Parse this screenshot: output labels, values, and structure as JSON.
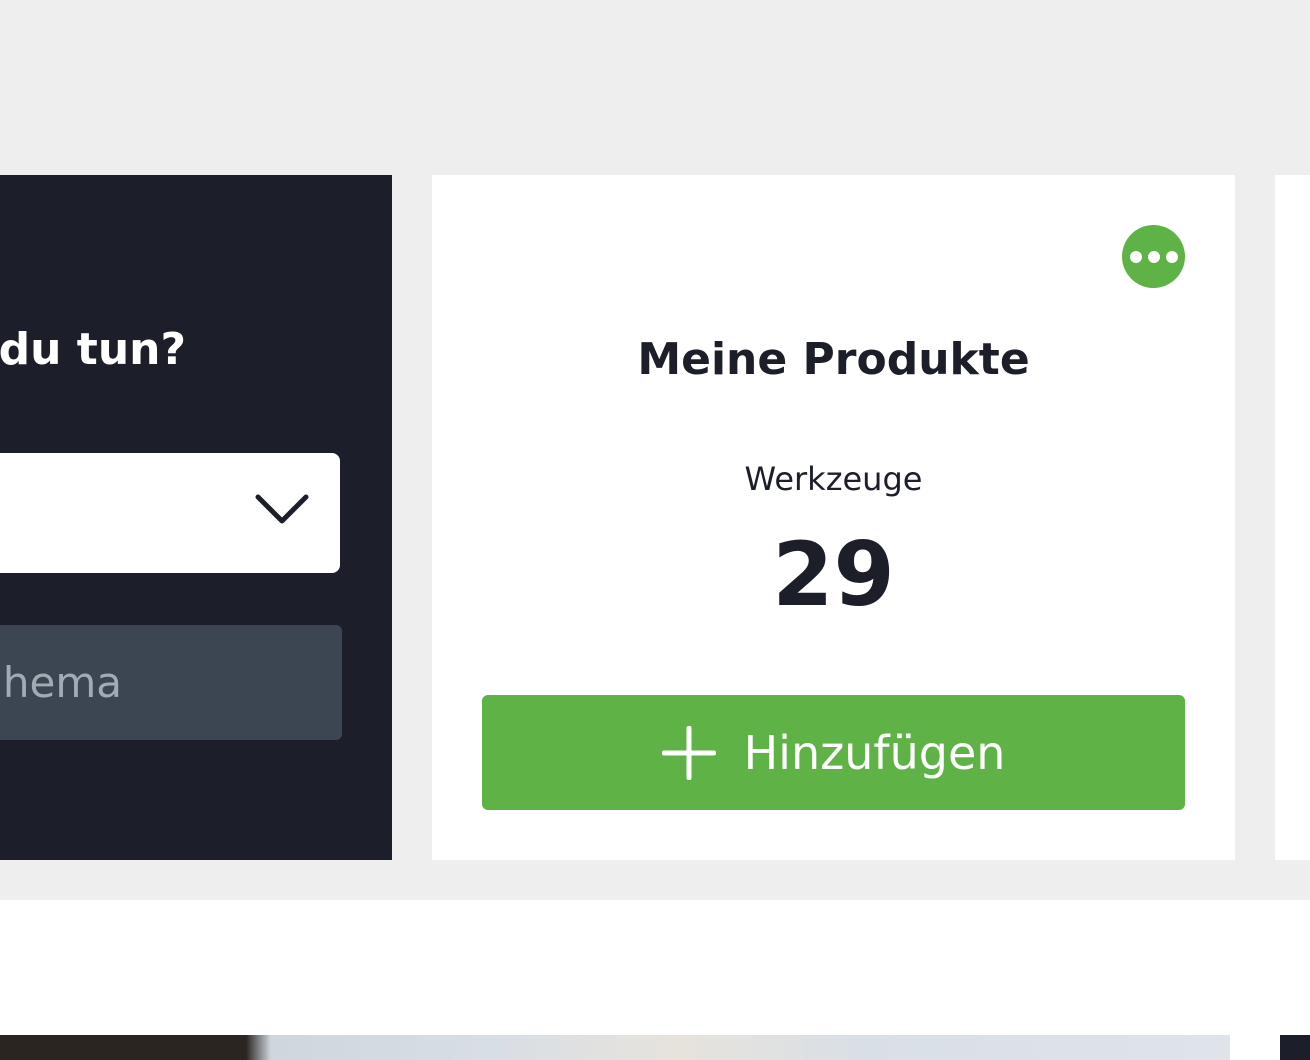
{
  "question_card": {
    "title": "du tun?",
    "search": {
      "placeholder": "hema"
    },
    "select_icon": "chevron-down-icon"
  },
  "product_card": {
    "title": "Meine Produkte",
    "stat_label": "Werkzeuge",
    "stat_value": "29",
    "more_icon": "more-dots-icon",
    "add_button_label": "Hinzufügen",
    "add_icon": "plus-icon"
  },
  "colors": {
    "accent_green": "#5fb246",
    "dark_navy": "#1c1f29",
    "page_gray": "#eeeeee",
    "search_bg": "#3c4653"
  }
}
